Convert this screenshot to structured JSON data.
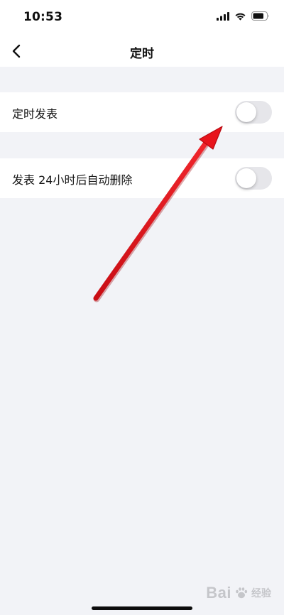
{
  "status_bar": {
    "time": "10:53",
    "icons": [
      "cellular-signal-icon",
      "wifi-icon",
      "battery-icon"
    ]
  },
  "nav": {
    "title": "定时",
    "back_icon": "chevron-left-icon"
  },
  "settings": [
    {
      "label": "定时发表",
      "enabled": false
    },
    {
      "label": "发表 24小时后自动删除",
      "enabled": false
    }
  ],
  "annotation": {
    "type": "red-arrow",
    "color": "#e8141c",
    "points_to": "定时发表"
  },
  "watermark": {
    "text": "Bai",
    "sub": "经验"
  },
  "colors": {
    "background": "#f2f3f7",
    "card": "#ffffff",
    "toggle_off": "#e6e6ea",
    "arrow": "#e8141c"
  }
}
